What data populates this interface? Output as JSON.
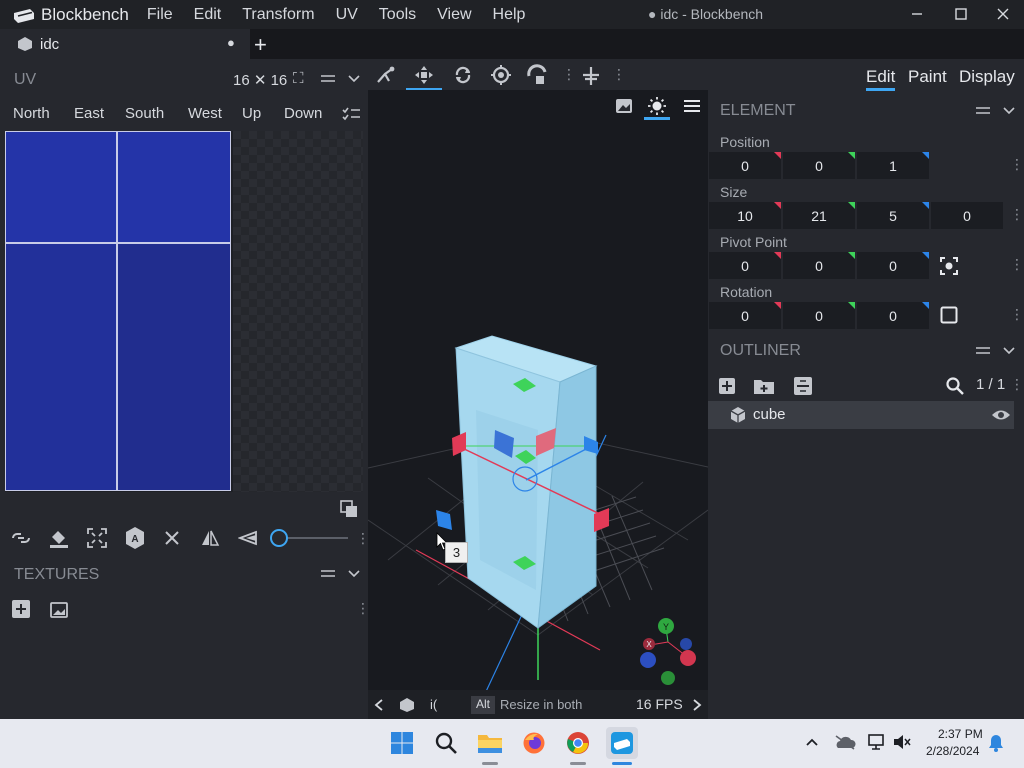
{
  "app": {
    "name": "Blockbench",
    "window_title": "● idc - Blockbench",
    "menu": [
      "File",
      "Edit",
      "Transform",
      "UV",
      "Tools",
      "View",
      "Help"
    ]
  },
  "tab": {
    "label": "idc"
  },
  "uv_panel": {
    "title": "UV",
    "size_label": "16 ✕ 16",
    "faces": [
      "North",
      "East",
      "South",
      "West",
      "Up",
      "Down"
    ]
  },
  "textures_panel": {
    "title": "TEXTURES"
  },
  "modes": [
    "Edit",
    "Paint",
    "Display"
  ],
  "element_panel": {
    "title": "ELEMENT",
    "position": {
      "label": "Position",
      "values": [
        "0",
        "0",
        "1"
      ]
    },
    "size": {
      "label": "Size",
      "values": [
        "10",
        "21",
        "5",
        "0"
      ]
    },
    "pivot": {
      "label": "Pivot Point",
      "values": [
        "0",
        "0",
        "0"
      ]
    },
    "rotation": {
      "label": "Rotation",
      "values": [
        "0",
        "0",
        "0"
      ]
    }
  },
  "outliner": {
    "title": "OUTLINER",
    "count": "1 / 1",
    "items": [
      {
        "label": "cube"
      }
    ]
  },
  "viewport": {
    "tooltip": "3",
    "statusbar": {
      "model": "i(",
      "key": "Alt",
      "hint": "Resize in both",
      "fps": "16 FPS"
    },
    "gizmo_labels": {
      "y": "Y",
      "x": "X"
    }
  },
  "taskbar": {
    "time": "2:37 PM",
    "date": "2/28/2024"
  },
  "colors": {
    "accent": "#3ea6f2",
    "uv_texture": "#2232a0",
    "axis_red": "#e23a57",
    "axis_green": "#3ed35a",
    "axis_blue": "#2c84e8"
  }
}
